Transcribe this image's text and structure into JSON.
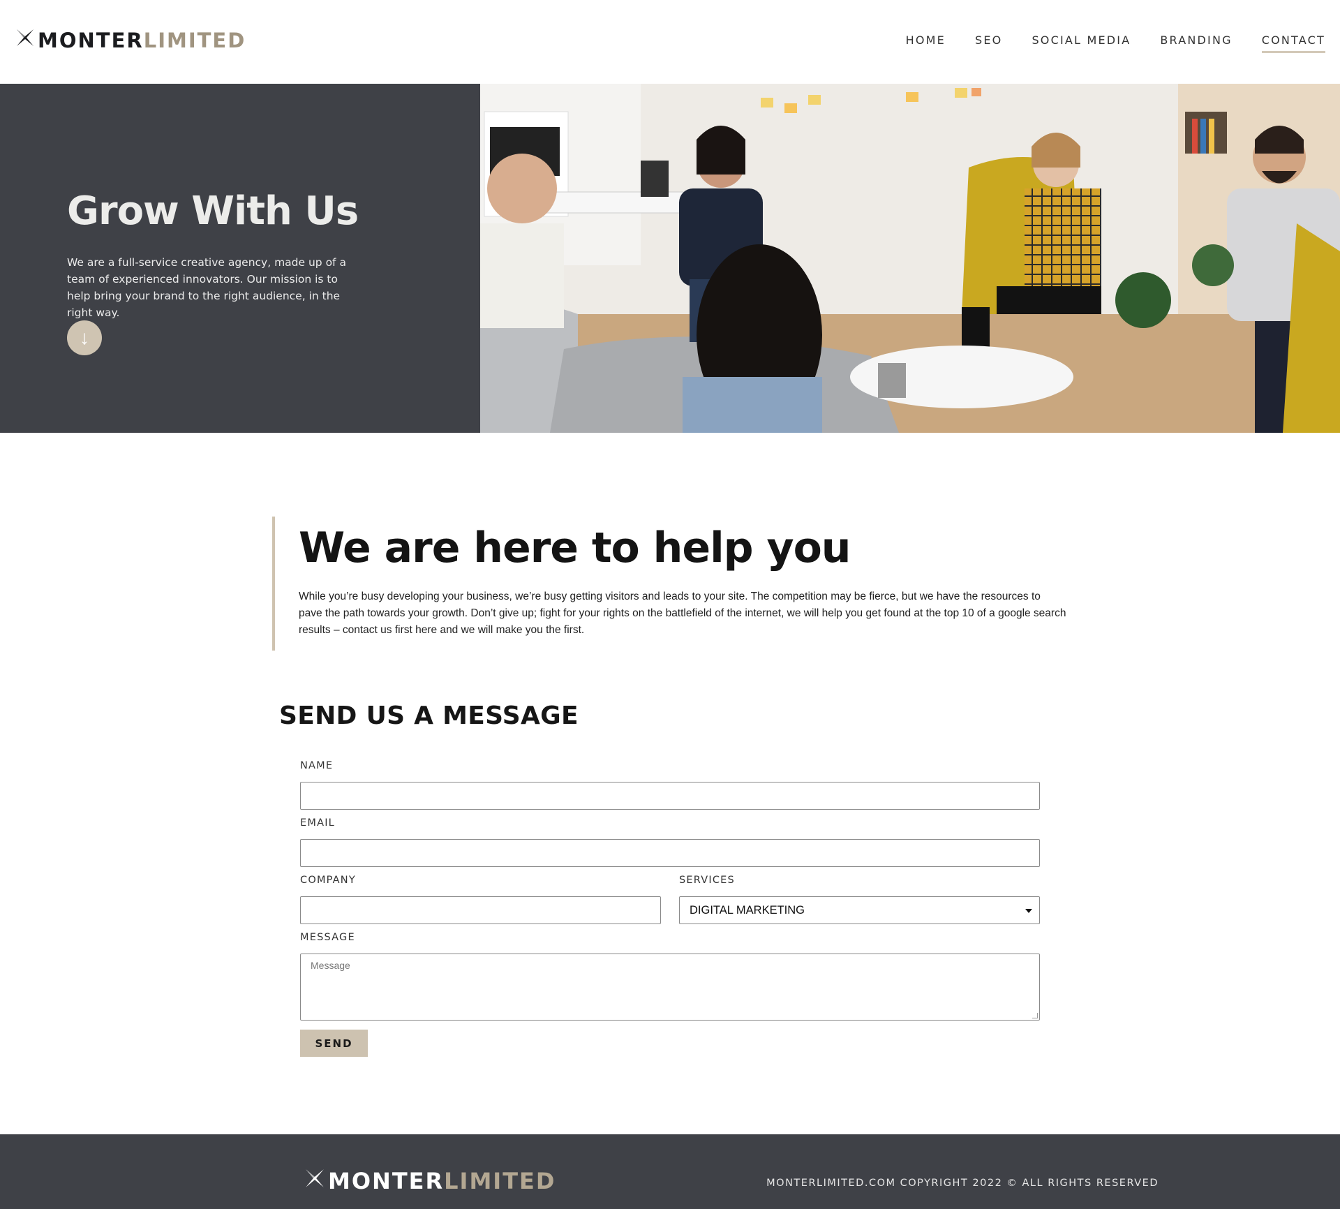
{
  "brand": {
    "logo_part1": "MONTER",
    "logo_part2": "LIMITED"
  },
  "nav": {
    "items": [
      {
        "label": "HOME"
      },
      {
        "label": "SEO"
      },
      {
        "label": "SOCIAL MEDIA"
      },
      {
        "label": "BRANDING"
      },
      {
        "label": "CONTACT"
      }
    ],
    "active": "CONTACT"
  },
  "hero": {
    "title": "Grow With Us",
    "text": "We are a full-service creative agency, made up of a team of experienced innovators. Our mission is to help bring your brand to the right audience, in the right way.",
    "scroll_icon": "arrow-down-icon",
    "scroll_glyph": "↓"
  },
  "help": {
    "title": "We are here to help you",
    "text": "While you’re busy developing your business, we’re busy getting visitors and leads to your site. The competition may be fierce, but we have the resources to pave the path towards your growth. Don’t give up; fight for your rights on the battlefield of the internet, we will help you get found at the top 10 of a google search results – contact us first here and we will make you the first."
  },
  "form": {
    "title": "SEND US A MESSAGE",
    "name_label": "NAME",
    "name_value": "",
    "email_label": "EMAIL",
    "email_value": "",
    "company_label": "COMPANY",
    "company_value": "",
    "services_label": "SERVICES",
    "services_selected": "DIGITAL MARKETING",
    "message_label": "MESSAGE",
    "message_placeholder": "Message",
    "send_label": "SEND"
  },
  "footer": {
    "logo_part1": "MONTER",
    "logo_part2": "LIMITED",
    "copyright": "MONTERLIMITED.COM COPYRIGHT 2022 © ALL RIGHTS RESERVED"
  },
  "colors": {
    "dark": "#3f4147",
    "accent": "#cdc2b0",
    "logo_accent": "#a09480"
  }
}
